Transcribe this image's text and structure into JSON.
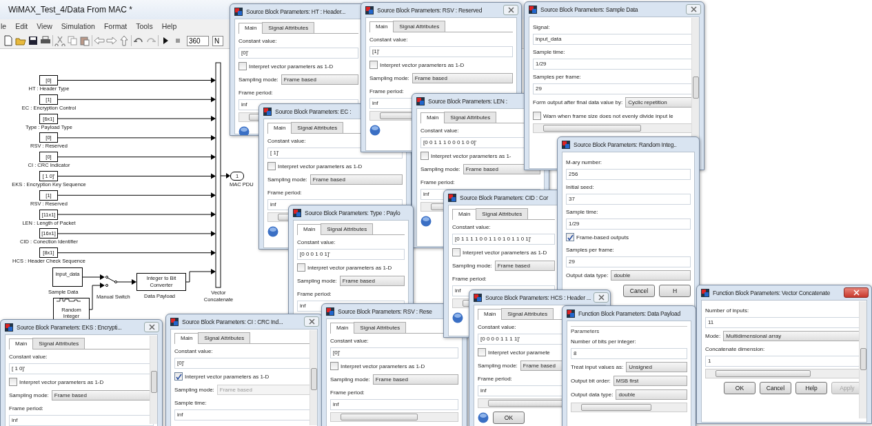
{
  "model": {
    "title": "WiMAX_Test_4/Data From MAC *",
    "menu": [
      "le",
      "Edit",
      "View",
      "Simulation",
      "Format",
      "Tools",
      "Help"
    ],
    "stop_time": "360",
    "sim_mode": "N",
    "constants": [
      {
        "value": "[0]",
        "label": "HT : Header Type"
      },
      {
        "value": "[1]",
        "label": "EC : Encryption Control"
      },
      {
        "value": "[6x1]",
        "label": "Type : Payload Type"
      },
      {
        "value": "[0]",
        "label": "RSV : Reserved"
      },
      {
        "value": "[0]",
        "label": "CI : CRC Indicator"
      },
      {
        "value": "[ 1 0]'",
        "label": "EKS : Encryption Key Sequence"
      },
      {
        "value": "[1]",
        "label": "RSV : Reserved"
      },
      {
        "value": "[11x1]",
        "label": "LEN : Length of Packet"
      },
      {
        "value": "[16x1]",
        "label": "CID : Conection Identifier"
      },
      {
        "value": "[8x1]",
        "label": "HCS : Header Check Sequence"
      }
    ],
    "output": {
      "number": "1",
      "label": "MAC PDU"
    },
    "concat_label": "Vector Concatenate",
    "source": {
      "value": "input_data",
      "label": "Sample Data"
    },
    "switch_label": "Manual Switch",
    "converter": {
      "text": "Integer to Bit Converter",
      "label": "Data Payload"
    },
    "random": {
      "text": "Random Integer"
    }
  },
  "dialogs": [
    {
      "title": "Source Block Parameters: HT : Header...",
      "tabs": [
        {
          "label": "Main",
          "selected": true
        },
        {
          "label": "Signal Attributes",
          "selected": false
        }
      ],
      "rows": [
        {
          "kind": "label",
          "text": "Constant value:"
        },
        {
          "kind": "field",
          "value": "[0]'"
        },
        {
          "kind": "checkbox",
          "label": "Interpret vector parameters as 1-D",
          "checked": false
        },
        {
          "kind": "select",
          "label": "Sampling mode:",
          "value": "Frame based",
          "disabled": false
        },
        {
          "kind": "label",
          "text": "Frame period:"
        },
        {
          "kind": "field",
          "value": "inf"
        },
        {
          "kind": "scrollbar"
        },
        {
          "kind": "buttons",
          "help": true,
          "buttons": []
        }
      ]
    },
    {
      "title": "Source Block Parameters: EC :",
      "tabs": [
        {
          "label": "Main",
          "selected": true
        },
        {
          "label": "Signal Attributes",
          "selected": false
        }
      ],
      "rows": [
        {
          "kind": "label",
          "text": "Constant value:"
        },
        {
          "kind": "field",
          "value": "[ 1]'"
        },
        {
          "kind": "checkbox",
          "label": "Interpret vector parameters as 1-D",
          "checked": false
        },
        {
          "kind": "select",
          "label": "Sampling mode:",
          "value": "Frame based",
          "disabled": false
        },
        {
          "kind": "label",
          "text": "Frame period:"
        },
        {
          "kind": "field",
          "value": "inf"
        },
        {
          "kind": "scrollbar"
        },
        {
          "kind": "buttons",
          "help": true,
          "buttons": []
        }
      ]
    },
    {
      "title": "Source Block Parameters: RSV : Reserved",
      "close_button": true,
      "tabs": [
        {
          "label": "Main",
          "selected": true
        },
        {
          "label": "Signal Attributes",
          "selected": false
        }
      ],
      "rows": [
        {
          "kind": "label",
          "text": "Constant value:"
        },
        {
          "kind": "field",
          "value": "[1]'"
        },
        {
          "kind": "checkbox",
          "label": "Interpret vector parameters as 1-D",
          "checked": false
        },
        {
          "kind": "select",
          "label": "Sampling mode:",
          "value": "Frame based",
          "disabled": false
        },
        {
          "kind": "label",
          "text": "Frame period:"
        },
        {
          "kind": "field",
          "value": "inf"
        },
        {
          "kind": "scrollbar"
        },
        {
          "kind": "buttons",
          "help": true,
          "buttons": []
        }
      ]
    },
    {
      "title": "Source Block Parameters: LEN :",
      "tabs": [
        {
          "label": "Main",
          "selected": true
        },
        {
          "label": "Signal Attributes",
          "selected": false
        }
      ],
      "rows": [
        {
          "kind": "label",
          "text": "Constant value:"
        },
        {
          "kind": "field",
          "value": "[0 0 1 1 1 0 0 0 1 0 0]'"
        },
        {
          "kind": "checkbox",
          "label": "Interpret vector parameters as 1-",
          "checked": false
        },
        {
          "kind": "select",
          "label": "Sampling mode:",
          "value": "Frame based",
          "disabled": false
        },
        {
          "kind": "label",
          "text": "Frame period:"
        },
        {
          "kind": "field",
          "value": "inf"
        },
        {
          "kind": "scrollbar"
        },
        {
          "kind": "buttons",
          "help": true,
          "buttons": []
        }
      ]
    },
    {
      "title": "Source Block Parameters: Sample Data",
      "close_button": true,
      "vscroll": true,
      "rows": [
        {
          "kind": "label",
          "text": "Signal:"
        },
        {
          "kind": "field",
          "value": "input_data"
        },
        {
          "kind": "label",
          "text": "Sample time:"
        },
        {
          "kind": "field",
          "value": "1/29"
        },
        {
          "kind": "label",
          "text": "Samples per frame:"
        },
        {
          "kind": "field",
          "value": "29"
        },
        {
          "kind": "select",
          "label": "Form output after final data value by:",
          "value": "Cyclic repetition",
          "disabled": false
        },
        {
          "kind": "checkbox",
          "label": "Warn when frame size does not evenly divide input le",
          "checked": false
        },
        {
          "kind": "scrollbar"
        }
      ]
    },
    {
      "title": "Source Block Parameters: Type : Paylo",
      "tabs": [
        {
          "label": "Main",
          "selected": true
        },
        {
          "label": "Signal Attributes",
          "selected": false
        }
      ],
      "rows": [
        {
          "kind": "label",
          "text": "Constant value:"
        },
        {
          "kind": "field",
          "value": "[0 0 0 1 0 1]'"
        },
        {
          "kind": "checkbox",
          "label": "Interpret vector parameters as 1-D",
          "checked": false
        },
        {
          "kind": "select",
          "label": "Sampling mode:",
          "value": "Frame based",
          "disabled": false
        },
        {
          "kind": "label",
          "text": "Frame period:"
        },
        {
          "kind": "field",
          "value": "inf"
        }
      ]
    },
    {
      "title": "Source Block Parameters: CI : CRC Ind...",
      "close_button": true,
      "vscroll": true,
      "tabs": [
        {
          "label": "Main",
          "selected": true
        },
        {
          "label": "Signal Attributes",
          "selected": false
        }
      ],
      "rows": [
        {
          "kind": "label",
          "text": "Constant value:"
        },
        {
          "kind": "field",
          "value": "[0]'"
        },
        {
          "kind": "checkbox",
          "label": "Interpret vector parameters as 1-D",
          "checked": true
        },
        {
          "kind": "select",
          "label": "Sampling mode:",
          "value": "Frame based",
          "disabled": true
        },
        {
          "kind": "label",
          "text": "Sample time:"
        },
        {
          "kind": "field",
          "value": "inf"
        }
      ]
    },
    {
      "title": "Source Block Parameters: RSV : Rese",
      "tabs": [
        {
          "label": "Main",
          "selected": true
        },
        {
          "label": "Signal Attributes",
          "selected": false
        }
      ],
      "rows": [
        {
          "kind": "label",
          "text": "Constant value:"
        },
        {
          "kind": "field",
          "value": "[0]'"
        },
        {
          "kind": "checkbox",
          "label": "Interpret vector parameters as 1-D",
          "checked": false
        },
        {
          "kind": "select",
          "label": "Sampling mode:",
          "value": "Frame based",
          "disabled": false
        },
        {
          "kind": "label",
          "text": "Frame period:"
        },
        {
          "kind": "field",
          "value": "inf"
        },
        {
          "kind": "scrollbar"
        }
      ]
    },
    {
      "title": "Source Block Parameters: CID : Cor",
      "tabs": [
        {
          "label": "Main",
          "selected": true
        },
        {
          "label": "Signal Attributes",
          "selected": false
        }
      ],
      "rows": [
        {
          "kind": "label",
          "text": "Constant value:"
        },
        {
          "kind": "field",
          "value": "[0 1 1 1 1 0 0 1 1 0 1 0 1 1 0 1]'"
        },
        {
          "kind": "checkbox",
          "label": "Interpret vector parameters as 1-D",
          "checked": false
        },
        {
          "kind": "select",
          "label": "Sampling mode:",
          "value": "Frame based",
          "disabled": false
        },
        {
          "kind": "label",
          "text": "Frame period:"
        },
        {
          "kind": "field",
          "value": "inf"
        },
        {
          "kind": "scrollbar"
        },
        {
          "kind": "buttons",
          "help": true,
          "buttons": []
        }
      ]
    },
    {
      "title": "Source Block Parameters: Random Integ..",
      "rows": [
        {
          "kind": "label",
          "text": "M-ary number:"
        },
        {
          "kind": "field",
          "value": "256"
        },
        {
          "kind": "label",
          "text": "Initial seed:"
        },
        {
          "kind": "field",
          "value": "37"
        },
        {
          "kind": "label",
          "text": "Sample time:"
        },
        {
          "kind": "field",
          "value": "1/29"
        },
        {
          "kind": "checkbox",
          "label": "Frame-based outputs",
          "checked": true
        },
        {
          "kind": "label",
          "text": "Samples per frame:"
        },
        {
          "kind": "field",
          "value": "29"
        },
        {
          "kind": "select",
          "label": "Output data type:",
          "value": "double",
          "disabled": false
        },
        {
          "kind": "buttons",
          "buttons": [
            {
              "label": "Cancel",
              "disabled": false
            },
            {
              "label": "H",
              "disabled": false
            }
          ]
        }
      ]
    },
    {
      "title": "Source Block Parameters: HCS : Header ...",
      "close_button": true,
      "tabs": [
        {
          "label": "Main",
          "selected": true
        },
        {
          "label": "Signal Attributes",
          "selected": false
        }
      ],
      "rows": [
        {
          "kind": "label",
          "text": "Constant value:"
        },
        {
          "kind": "field",
          "value": "[0 0 0 0 1 1 1 1]'"
        },
        {
          "kind": "checkbox",
          "label": "Interpret vector paramete",
          "checked": false
        },
        {
          "kind": "select",
          "label": "Sampling mode:",
          "value": "Frame based",
          "disabled": false
        },
        {
          "kind": "label",
          "text": "Frame period:"
        },
        {
          "kind": "field",
          "value": "inf"
        },
        {
          "kind": "scrollbar"
        },
        {
          "kind": "buttons",
          "help": true,
          "buttons": [
            {
              "label": "OK",
              "disabled": false
            }
          ]
        }
      ]
    },
    {
      "title": "Function Block Parameters: Data Payload",
      "rows": [
        {
          "kind": "group",
          "text": "Parameters"
        },
        {
          "kind": "label",
          "text": "Number of bits per integer:"
        },
        {
          "kind": "field",
          "value": "8"
        },
        {
          "kind": "select",
          "label": "Treat input values as:",
          "value": "Unsigned",
          "disabled": false
        },
        {
          "kind": "select",
          "label": "Output bit order:",
          "value": "MSB first",
          "disabled": false
        },
        {
          "kind": "select",
          "label": "Output data type:",
          "value": "double",
          "disabled": false
        },
        {
          "kind": "scrollbar"
        }
      ]
    },
    {
      "title": "Source Block Parameters: EKS : Encrypti...",
      "close_button": true,
      "vscroll": true,
      "tabs": [
        {
          "label": "Main",
          "selected": true
        },
        {
          "label": "Signal Attributes",
          "selected": false
        }
      ],
      "rows": [
        {
          "kind": "label",
          "text": "Constant value:"
        },
        {
          "kind": "field",
          "value": "[ 1 0]'"
        },
        {
          "kind": "checkbox",
          "label": "Interpret vector parameters as 1-D",
          "checked": false
        },
        {
          "kind": "select",
          "label": "Sampling mode:",
          "value": "Frame based",
          "disabled": false
        },
        {
          "kind": "label",
          "text": "Frame period:"
        },
        {
          "kind": "field",
          "value": "inf"
        }
      ]
    },
    {
      "title": "Function Block Parameters: Vector Concatenate",
      "close_button": true,
      "close_red": true,
      "vscroll": true,
      "rows": [
        {
          "kind": "label",
          "text": "Number of inputs:"
        },
        {
          "kind": "field",
          "value": "11"
        },
        {
          "kind": "select",
          "label": "Mode:",
          "value": "Multidimensional array",
          "disabled": false
        },
        {
          "kind": "label",
          "text": "Concatenate dimension:"
        },
        {
          "kind": "field",
          "value": "1"
        },
        {
          "kind": "scrollbar"
        },
        {
          "kind": "buttons",
          "buttons": [
            {
              "label": "OK",
              "disabled": false
            },
            {
              "label": "Cancel",
              "disabled": false
            },
            {
              "label": "Help",
              "disabled": false
            },
            {
              "label": "Apply",
              "disabled": true
            }
          ]
        }
      ]
    }
  ]
}
